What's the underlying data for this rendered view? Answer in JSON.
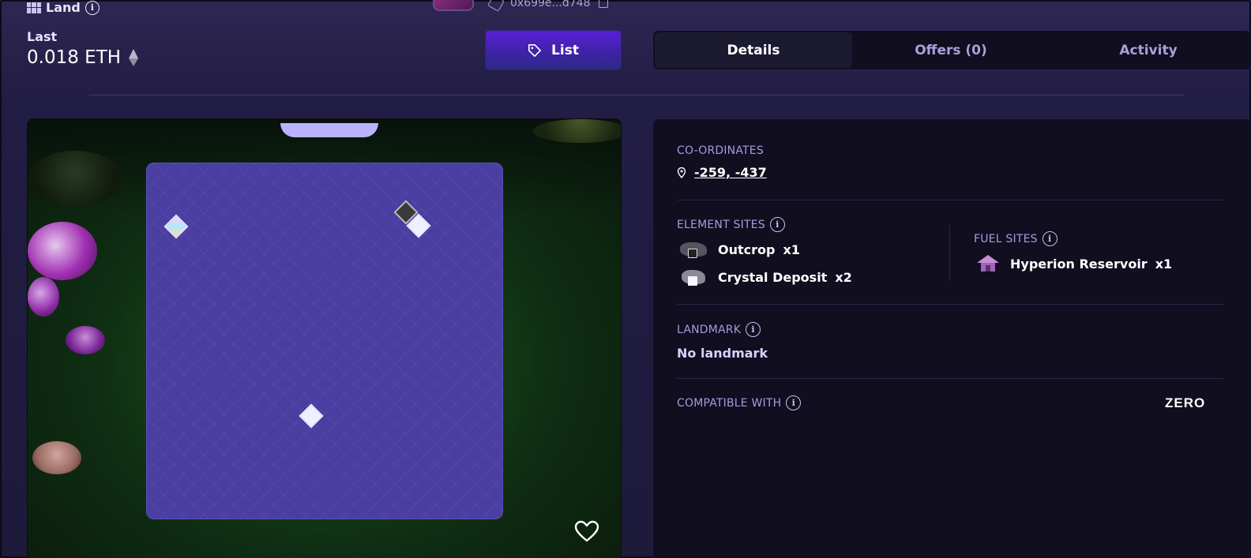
{
  "header": {
    "land_label": "Land",
    "owner_address": "0x699e...d748",
    "last_label": "Last",
    "last_price": "0.018 ETH"
  },
  "actions": {
    "list_label": "List"
  },
  "tabs": [
    {
      "label": "Details",
      "active": true
    },
    {
      "label": "Offers (0)",
      "active": false
    },
    {
      "label": "Activity",
      "active": false
    }
  ],
  "details": {
    "coordinates_label": "CO-ORDINATES",
    "coordinates_value": "-259, -437",
    "element_sites_label": "ELEMENT SITES",
    "element_sites": [
      {
        "name": "Outcrop",
        "count": "x1",
        "icon": "outcrop-icon"
      },
      {
        "name": "Crystal Deposit",
        "count": "x2",
        "icon": "crystal-deposit-icon"
      }
    ],
    "fuel_sites_label": "FUEL SITES",
    "fuel_sites": [
      {
        "name": "Hyperion Reservoir",
        "count": "x1",
        "icon": "hyperion-reservoir-icon"
      }
    ],
    "landmark_label": "LANDMARK",
    "landmark_value": "No landmark",
    "compatible_label": "COMPATIBLE WITH",
    "compatible_logo": "ZERO"
  },
  "colors": {
    "accent": "#5a1fd6",
    "panel_bg": "#100e1f",
    "label": "#a29ce0",
    "plot": "#4a3ea0"
  }
}
